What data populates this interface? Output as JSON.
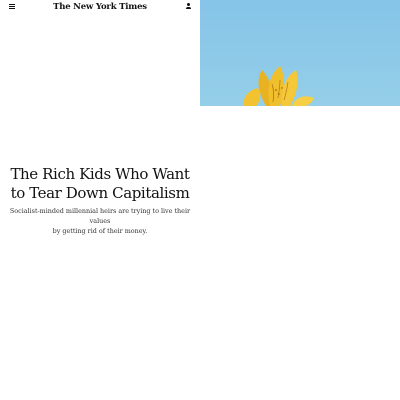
{
  "header": {
    "logo_text": "The New York Times",
    "menu_icon": "hamburger-menu-icon",
    "account_icon": "user-account-icon"
  },
  "hero": {
    "image_subject": "yellow flower against blue sky",
    "sky_color": "#8ecae8",
    "flower_color": "#f2c230"
  },
  "article": {
    "headline_line1": "The Rich Kids Who Want",
    "headline_line2": "to Tear Down Capitalism",
    "summary_line1": "Socialist-minded millennial heirs are trying to live their values",
    "summary_line2": "by getting rid of their money."
  }
}
